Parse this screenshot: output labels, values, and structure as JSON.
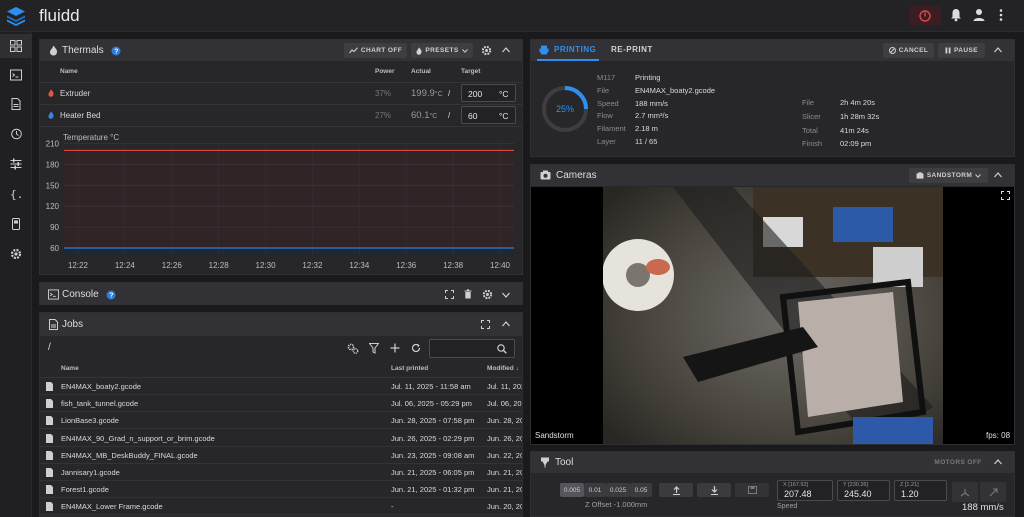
{
  "app": {
    "title": "fluidd"
  },
  "thermals": {
    "title": "Thermals",
    "chart_off_label": "CHART OFF",
    "presets_label": "PRESETS",
    "columns": {
      "name": "Name",
      "power": "Power",
      "actual": "Actual",
      "target": "Target"
    },
    "heaters": [
      {
        "name": "Extruder",
        "power": "37%",
        "actual": "199.9",
        "target": "200",
        "unit": "°C"
      },
      {
        "name": "Heater Bed",
        "power": "27%",
        "actual": "60.1",
        "target": "60",
        "unit": "°C"
      }
    ],
    "separator": "/"
  },
  "chart_data": {
    "type": "line",
    "title": "Temperature °C",
    "x": [
      "12:22",
      "12:24",
      "12:26",
      "12:28",
      "12:30",
      "12:32",
      "12:34",
      "12:36",
      "12:38",
      "12:40"
    ],
    "y_ticks": [
      60,
      90,
      120,
      150,
      180,
      210
    ],
    "ylim": [
      50,
      215
    ],
    "grid": true,
    "series": [
      {
        "values": [
          200,
          200,
          200,
          200,
          200,
          200,
          200,
          200,
          200,
          200
        ],
        "color": "#d9473f"
      },
      {
        "values": [
          60,
          60,
          60,
          60,
          60,
          60,
          60,
          60,
          60,
          60
        ],
        "color": "#2f7bd6"
      }
    ]
  },
  "console": {
    "title": "Console"
  },
  "jobs": {
    "title": "Jobs",
    "path": "/",
    "columns": {
      "name": "Name",
      "last_printed": "Last printed",
      "modified": "Modified"
    },
    "files": [
      {
        "name": "EN4MAX_boaty2.gcode",
        "last_printed": "Jul. 11, 2025 - 11:58 am",
        "modified": "Jul. 11, 202"
      },
      {
        "name": "fish_tank_tunnel.gcode",
        "last_printed": "Jul. 06, 2025 - 05:29 pm",
        "modified": "Jul. 06, 202"
      },
      {
        "name": "LionBase3.gcode",
        "last_printed": "Jun. 28, 2025 - 07:58 pm",
        "modified": "Jun. 28, 20"
      },
      {
        "name": "EN4MAX_90_Grad_n_support_or_brim.gcode",
        "last_printed": "Jun. 26, 2025 - 02:29 pm",
        "modified": "Jun. 26, 20"
      },
      {
        "name": "EN4MAX_MB_DeskBuddy_FINAL.gcode",
        "last_printed": "Jun. 23, 2025 - 09:08 am",
        "modified": "Jun. 22, 20"
      },
      {
        "name": "Jannisary1.gcode",
        "last_printed": "Jun. 21, 2025 - 06:05 pm",
        "modified": "Jun. 21, 20"
      },
      {
        "name": "Forest1.gcode",
        "last_printed": "Jun. 21, 2025 - 01:32 pm",
        "modified": "Jun. 21, 20"
      },
      {
        "name": "EN4MAX_Lower Frame.gcode",
        "last_printed": "-",
        "modified": "Jun. 20, 20"
      }
    ]
  },
  "printing": {
    "tab_printing": "PRINTING",
    "tab_reprint": "RE-PRINT",
    "cancel_label": "CANCEL",
    "pause_label": "PAUSE",
    "progress": 25,
    "progress_label": "25%",
    "left": [
      {
        "label": "M117",
        "value": "Printing"
      },
      {
        "label": "File",
        "value": "EN4MAX_boaty2.gcode"
      },
      {
        "label": "Speed",
        "value": "188 mm/s"
      },
      {
        "label": "Flow",
        "value": "2.7 mm³/s"
      },
      {
        "label": "Filament",
        "value": "2.18 m"
      },
      {
        "label": "Layer",
        "value": "11 / 65"
      }
    ],
    "right": [
      {
        "label": "File",
        "value": "2h 4m 20s"
      },
      {
        "label": "Slicer",
        "value": "1h 28m 32s"
      },
      {
        "label": "Total",
        "value": "41m 24s"
      },
      {
        "label": "Finish",
        "value": "02:09 pm"
      }
    ]
  },
  "cameras": {
    "title": "Cameras",
    "selected": "SANDSTORM",
    "camera_name": "Sandstorm",
    "fps": "fps: 08"
  },
  "tool": {
    "title": "Tool",
    "motors_off_label": "MOTORS OFF",
    "z_steps": [
      "0.005",
      "0.01",
      "0.025",
      "0.05"
    ],
    "z_offset_label": "Z Offset",
    "z_offset_value": "-1.000mm",
    "axes": [
      {
        "name": "X",
        "bracket": "[167.92]",
        "value": "207.48"
      },
      {
        "name": "Y",
        "bracket": "[230.26]",
        "value": "245.40"
      },
      {
        "name": "Z",
        "bracket": "[1.21]",
        "value": "1.20"
      }
    ],
    "speed_label": "Speed",
    "speed_value": "188 mm/s"
  }
}
